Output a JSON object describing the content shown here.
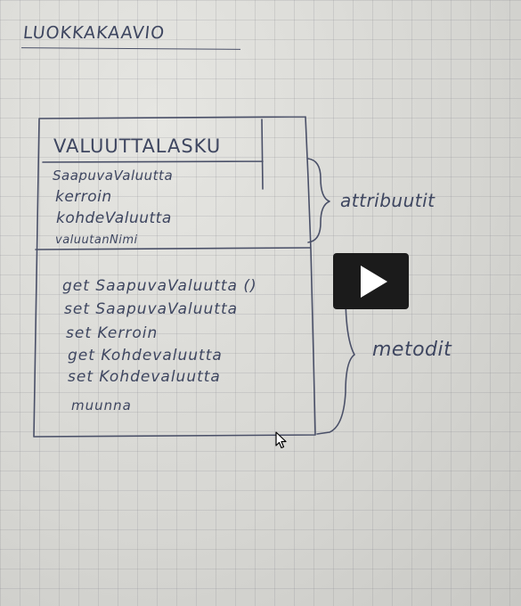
{
  "video": {
    "title": "LUOKKAKAAVIO",
    "class_name": "VALUUTTALASKU",
    "attributes": [
      "SaapuvaValuutta",
      "kerroin",
      "kohdeValuutta",
      "valuutanNimi"
    ],
    "methods": [
      "get SaapuvaValuutta ()",
      "set SaapuvaValuutta",
      "set Kerroin",
      "get Kohdevaluutta",
      "set Kohdevaluutta",
      "muunna"
    ],
    "brace_labels": {
      "attributes": "attribuutit",
      "methods": "metodit"
    }
  },
  "controls": {
    "play_icon": "play-icon",
    "cursor_icon": "mouse-pointer-icon"
  },
  "colors": {
    "ink": "#3e4660",
    "play_button_bg": "#1b1b1b",
    "paper": "#d8d8d4"
  }
}
